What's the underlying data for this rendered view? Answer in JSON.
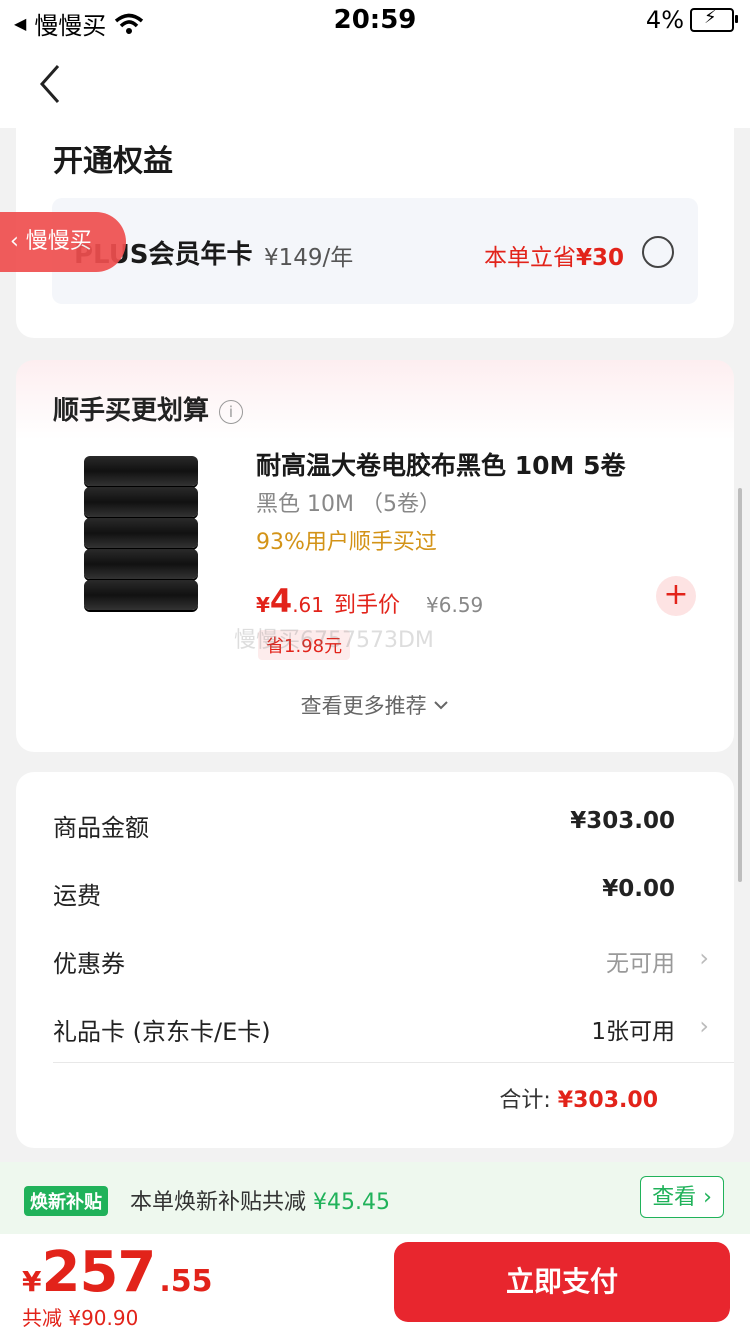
{
  "status_bar": {
    "app": "慢慢买",
    "time": "20:59",
    "battery": "4%"
  },
  "benefits": {
    "title": "开通权益",
    "plus_name": "PLUS会员年卡",
    "plus_price": "¥149/年",
    "plus_save_prefix": "本单立省",
    "plus_save_amount": "¥30"
  },
  "float_tag": {
    "label": "慢慢买"
  },
  "addon": {
    "title": "顺手买更划算",
    "product": {
      "name": "耐高温大卷电胶布黑色 10M 5卷",
      "spec": "黑色 10M （5卷）",
      "bought": "93%用户顺手买过",
      "price_yen": "¥",
      "price_int": "4",
      "price_dec": ".61",
      "price_label": "到手价",
      "orig_price": "¥6.59",
      "save": "省1.98元",
      "watermark": "慢慢买6757573DM"
    },
    "more": "查看更多推荐"
  },
  "summary": {
    "rows": [
      {
        "label": "商品金额",
        "value": "¥303.00"
      },
      {
        "label": "运费",
        "value": "¥0.00"
      },
      {
        "label": "优惠券",
        "value": "无可用"
      },
      {
        "label": "礼品卡 (京东卡/E卡)",
        "value": "1张可用"
      }
    ],
    "total_label": "合计:",
    "total_value": "¥303.00"
  },
  "subsidy": {
    "tag": "焕新补贴",
    "text": "本单焕新补贴共减",
    "amount": "¥45.45",
    "button": "查看"
  },
  "bottom": {
    "yen": "¥",
    "price_int": "257",
    "price_dec": ".55",
    "saved": "共减 ¥90.90",
    "pay_button": "立即支付"
  },
  "colors": {
    "accent": "#e2231a",
    "green": "#20b25a",
    "pay": "#e8262e"
  }
}
